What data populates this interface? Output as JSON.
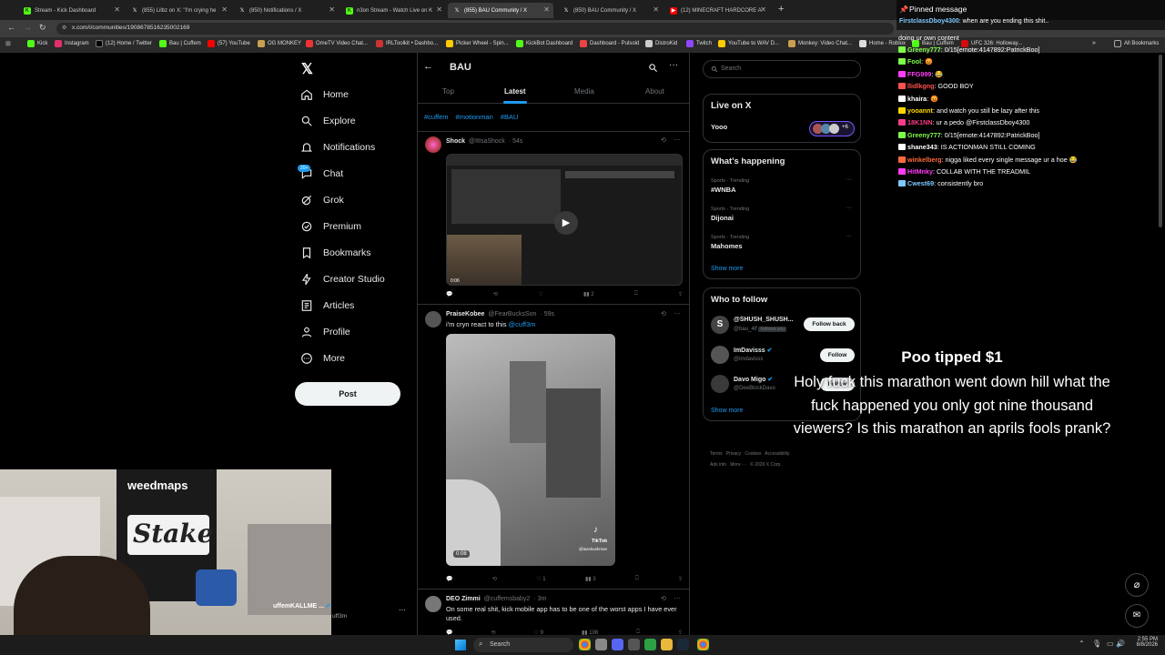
{
  "browser": {
    "tabs": [
      "Stream - Kick Dashboard",
      "(855) Lilbz on X: \"I'm crying he",
      "(850) Notifications / X",
      "n3on Stream - Watch Live on K",
      "(855) BAU Community / X",
      "(850) BAU Community / X",
      "(12) MINECRAFT HARDCORE A"
    ],
    "url": "x.com/i/communities/1908678516235002169",
    "bookmarks": [
      "Kick",
      "Instagram",
      "(12) Home / Twitter",
      "Bau | Cuffem",
      "(57) YouTube",
      "OG MONKEY",
      "OmeTV Video Chat...",
      "IRLToolkit • Dashbo...",
      "Picker Wheel - Spin...",
      "KickBot Dashboard",
      "Dashboard - Pulsoid",
      "DistroKid",
      "Twitch",
      "YouTube to WAV D...",
      "Monkey: Video Chat...",
      "Home - Roblox",
      "Bau | Cuffem",
      "UFC 326: Holloway..."
    ],
    "all_bookmarks": "All Bookmarks"
  },
  "nav": {
    "items": [
      "Home",
      "Explore",
      "Notifications",
      "Chat",
      "Grok",
      "Premium",
      "Bookmarks",
      "Creator Studio",
      "Articles",
      "Profile",
      "More"
    ],
    "chat_badge": "20+",
    "post": "Post"
  },
  "community": {
    "title": "BAU",
    "tabs": [
      "Top",
      "Latest",
      "Media",
      "About"
    ],
    "hashtags": [
      "#cuffem",
      "#motionman",
      "#BAU"
    ]
  },
  "tweets": [
    {
      "name": "Shock",
      "handle": "@ItIsaShock",
      "time": "· 54s",
      "text": "",
      "views": "2",
      "likes": "",
      "video_time": "0:06"
    },
    {
      "name": "PraiseKobee",
      "handle": "@FearBucksSon",
      "time": "· 59s",
      "text": "i'm cryn react to this",
      "mention": "@cuff3m",
      "likes": "1",
      "views": "3",
      "video_time": "0:08",
      "watermark": "TikTok",
      "wm_handle": "@lazekushman"
    },
    {
      "name": "DEO Zimmi",
      "handle": "@cuffemsbaby2",
      "time": "· 3m",
      "text": "On some real shit, kick mobile app has to be one of the worst apps I have ever used.",
      "likes": "9",
      "views": "106"
    }
  ],
  "right": {
    "search_placeholder": "Search",
    "live_title": "Live on X",
    "live_item": "Yooo",
    "live_count": "+6",
    "happening_title": "What's happening",
    "trends": [
      {
        "meta": "Sports · Trending",
        "name": "#WNBA"
      },
      {
        "meta": "Sports · Trending",
        "name": "Dijonai"
      },
      {
        "meta": "Sports · Trending",
        "name": "Mahomes"
      }
    ],
    "show_more": "Show more",
    "wtf_title": "Who to follow",
    "follows": [
      {
        "name": "@SHUSH_SHUSH...",
        "handle": "@bau_4lf",
        "btn": "Follow back",
        "follows_you": "Follows you"
      },
      {
        "name": "ImDavisss",
        "handle": "@imdavisss",
        "btn": "Follow"
      },
      {
        "name": "Davo Migo",
        "handle": "@DeeBlockDavo",
        "btn": "Follow"
      }
    ],
    "show_more2": "Show more",
    "footer1": "Terms   Privacy   Cookies   Accessibility",
    "footer2": "Ads info   More ···   © 2026 X Corp."
  },
  "chat": {
    "pinned_label": "Pinned message",
    "pinned_user": "FirstclassDboy4300",
    "pinned_text": ": when are you ending this shit..",
    "lines": [
      {
        "u": "Greeny777",
        "c": "#7cff4a",
        "t": ": 0/15[emote:4147892:PatrickBoo]"
      },
      {
        "u": "Fool",
        "c": "#7cff4a",
        "t": ": 😡"
      },
      {
        "u": "FFG999",
        "c": "#ff3df5",
        "t": ": 😂"
      },
      {
        "u": "llidlkgng",
        "c": "#ff5050",
        "t": ": GOOD BOY"
      },
      {
        "u": "khaira",
        "c": "#ffffff",
        "t": ": 😡"
      },
      {
        "u": "yooannt",
        "c": "#ffd700",
        "t": ": and watch you still be lazy after this"
      },
      {
        "u": "18K1NN",
        "c": "#ff3d8b",
        "t": ": ur a pedo @FirstclassDboy4300"
      },
      {
        "u": "Greeny777",
        "c": "#7cff4a",
        "t": ": 0/15[emote:4147892:PatrickBoo]"
      },
      {
        "u": "shane343",
        "c": "#ffffff",
        "t": ": IS ACTIONMAN STILL COMING"
      },
      {
        "u": "winkelberg",
        "c": "#ff6a3d",
        "t": ": nigga liked every single message ur a hoe 😂"
      },
      {
        "u": "HitMnky",
        "c": "#ff3df5",
        "t": ": COLLAB WITH THE TREADMIL"
      },
      {
        "u": "Cwest69",
        "c": "#7cc8ff",
        "t": ": consistently bro"
      }
    ],
    "top_partial": "doing ur own content"
  },
  "tip": {
    "title": "Poo tipped $1",
    "message": "Holy fuck this marathon went down hill what the fuck happened you only got nine thousand viewers? Is this marathon an aprils fools prank?"
  },
  "webcam": {
    "banner": "weedmaps",
    "logo": "Stake",
    "account_name": "uffemKALLME ...",
    "account_handle": "uff3m"
  },
  "taskbar": {
    "search": "Search",
    "time": "2:55 PM",
    "date": "8/8/2026"
  }
}
